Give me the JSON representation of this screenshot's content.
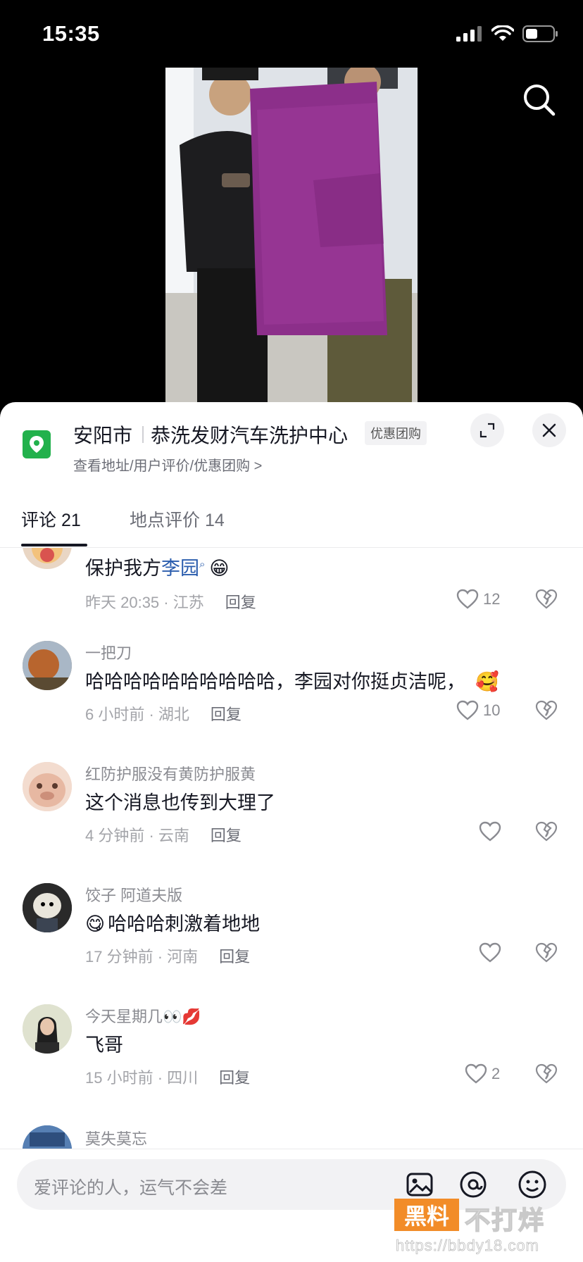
{
  "status_bar": {
    "time": "15:35"
  },
  "location": {
    "city": "安阳市",
    "name": "恭洗发财汽车洗护中心",
    "badge": "优惠团购",
    "links": "查看地址/用户评价/优惠团购 >"
  },
  "tabs": [
    {
      "label": "评论 21"
    },
    {
      "label": "地点评价 14"
    }
  ],
  "comments": [
    {
      "username": "",
      "text": "保护我方",
      "mention": "李园",
      "emoji": "😁",
      "meta": "昨天 20:35 · 江苏",
      "reply": "回复",
      "likes": "12"
    },
    {
      "username": "一把刀",
      "text": "哈哈哈哈哈哈哈哈哈哈，李园对你挺贞洁呢，",
      "emoji": "🥰",
      "meta": "6 小时前 · 湖北",
      "reply": "回复",
      "likes": "10"
    },
    {
      "username": "红防护服没有黄防护服黄",
      "text": "这个消息也传到大理了",
      "meta": "4 分钟前 · 云南",
      "reply": "回复",
      "likes": ""
    },
    {
      "username": "饺子 阿道夫版",
      "emoji": "😋",
      "text": "哈哈哈刺激着地地",
      "meta": "17 分钟前 · 河南",
      "reply": "回复",
      "likes": ""
    },
    {
      "username": "今天星期几👀💋",
      "text": "飞哥",
      "meta": "15 小时前 · 四川",
      "reply": "回复",
      "likes": "2"
    },
    {
      "username": "莫失莫忘"
    }
  ],
  "input": {
    "placeholder": "爱评论的人，运气不会差"
  },
  "watermark": {
    "box": "黑料",
    "text": "不打烊",
    "url": "https://bbdy18.com"
  },
  "colors": {
    "accent": "#22b14c",
    "mention": "#2a5cad",
    "watermark": "#f28c28"
  }
}
